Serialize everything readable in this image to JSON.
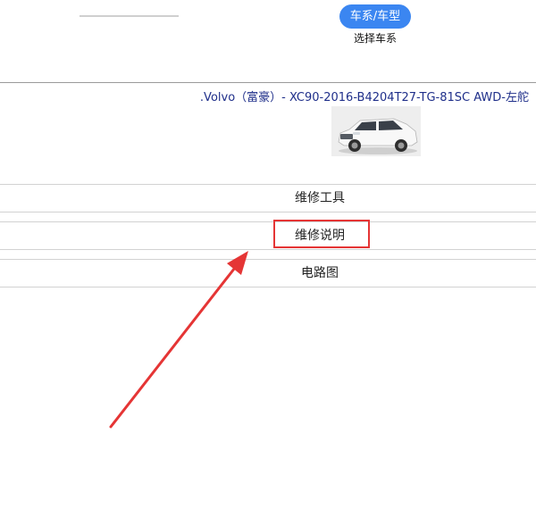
{
  "header": {
    "series_button_label": "车系/车型",
    "series_caption": "选择车系"
  },
  "vehicle": {
    "title": ".Volvo（富豪）- XC90-2016-B4204T27-TG-81SC AWD-左舵"
  },
  "menu": {
    "items": [
      {
        "label": "维修工具"
      },
      {
        "label": "维修说明"
      },
      {
        "label": "电路图"
      }
    ]
  },
  "annotation": {
    "highlight_color": "#e53535",
    "arrow_color": "#e53535"
  },
  "colors": {
    "accent": "#3b86f1",
    "vehicle_title": "#1f2f8a"
  }
}
